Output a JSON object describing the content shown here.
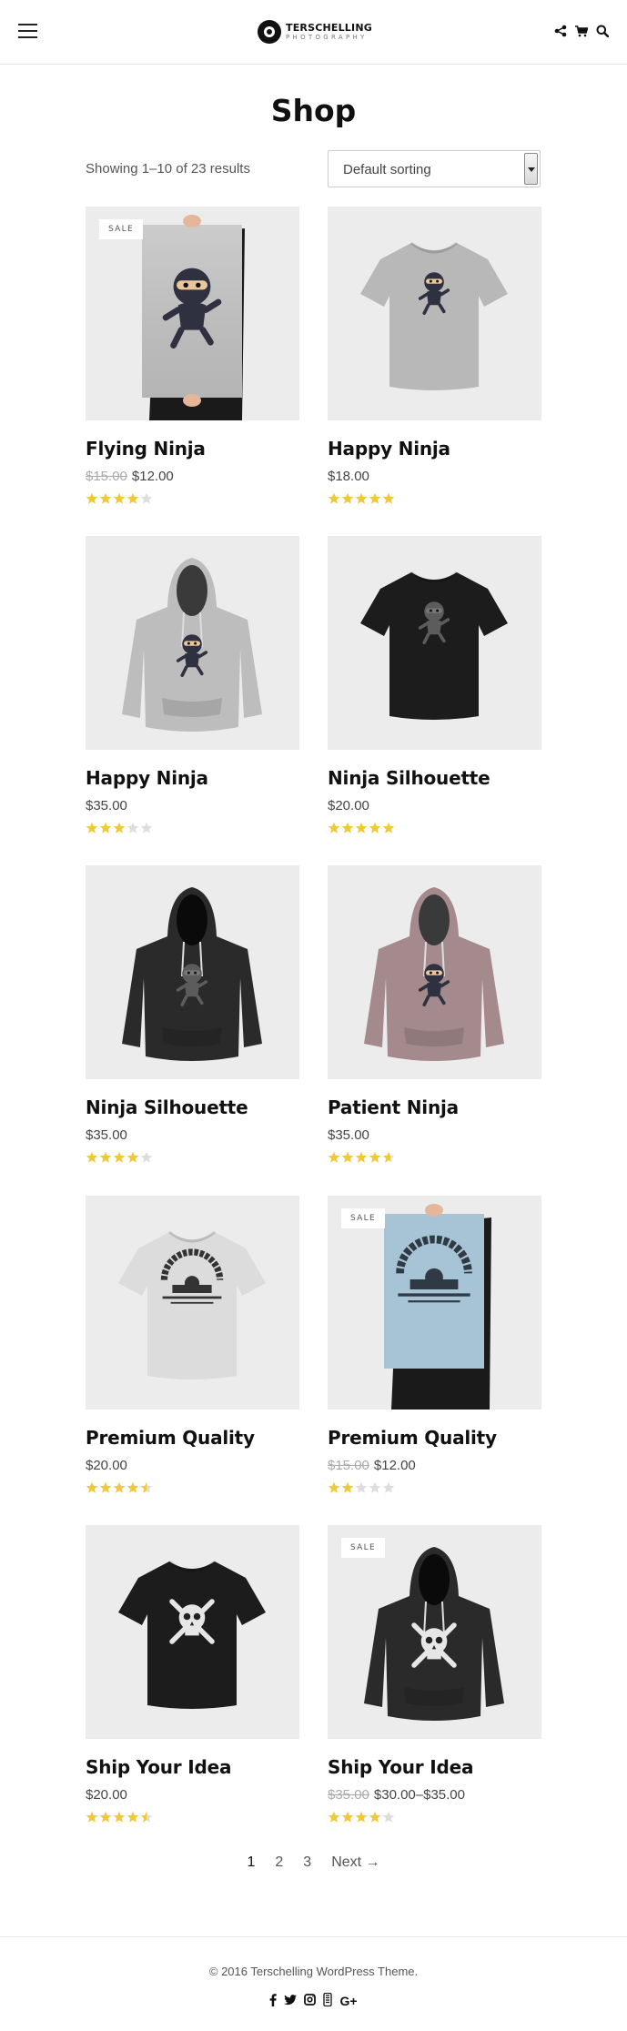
{
  "header": {
    "logo_title": "TERSCHELLING",
    "logo_subtitle": "PHOTOGRAPHY"
  },
  "page_title": "Shop",
  "result_count": "Showing 1–10 of 23 results",
  "sorting": {
    "selected": "Default sorting"
  },
  "sale_label": "SALE",
  "products": [
    {
      "title": "Flying Ninja",
      "old_price": "$15.00",
      "price": "$12.00",
      "sale": true,
      "rating": 4,
      "image": "poster-ninja"
    },
    {
      "title": "Happy Ninja",
      "old_price": "",
      "price": "$18.00",
      "sale": false,
      "rating": 5,
      "image": "tshirt-grey-ninja"
    },
    {
      "title": "Happy Ninja",
      "old_price": "",
      "price": "$35.00",
      "sale": false,
      "rating": 3,
      "image": "hoodie-grey-ninja"
    },
    {
      "title": "Ninja Silhouette",
      "old_price": "",
      "price": "$20.00",
      "sale": false,
      "rating": 5,
      "image": "tshirt-black-ninja"
    },
    {
      "title": "Ninja Silhouette",
      "old_price": "",
      "price": "$35.00",
      "sale": false,
      "rating": 4,
      "image": "hoodie-black-ninja"
    },
    {
      "title": "Patient Ninja",
      "old_price": "",
      "price": "$35.00",
      "sale": false,
      "rating": 4.67,
      "image": "hoodie-mauve-ninja"
    },
    {
      "title": "Premium Quality",
      "old_price": "",
      "price": "$20.00",
      "sale": false,
      "rating": 4.5,
      "image": "tshirt-white-woo"
    },
    {
      "title": "Premium Quality",
      "old_price": "$15.00",
      "price": "$12.00",
      "sale": true,
      "rating": 2,
      "image": "poster-woo"
    },
    {
      "title": "Ship Your Idea",
      "old_price": "",
      "price": "$20.00",
      "sale": false,
      "rating": 4.5,
      "image": "tshirt-black-skull"
    },
    {
      "title": "Ship Your Idea",
      "old_price": "$35.00",
      "price": "$30.00–$35.00",
      "sale": true,
      "rating": 4,
      "image": "hoodie-black-skull"
    }
  ],
  "pagination": {
    "pages": [
      "1",
      "2",
      "3"
    ],
    "current": "1",
    "next": "Next →"
  },
  "footer": {
    "copyright": "© 2016 Terschelling WordPress Theme.",
    "social": [
      "facebook-icon",
      "twitter-icon",
      "instagram-icon",
      "vimeo-icon",
      "google-plus-icon"
    ],
    "gplus_label": "G+"
  },
  "colors": {
    "star": "#f0c93a",
    "star_empty": "#dddddd",
    "image_bg": "#ececec"
  }
}
